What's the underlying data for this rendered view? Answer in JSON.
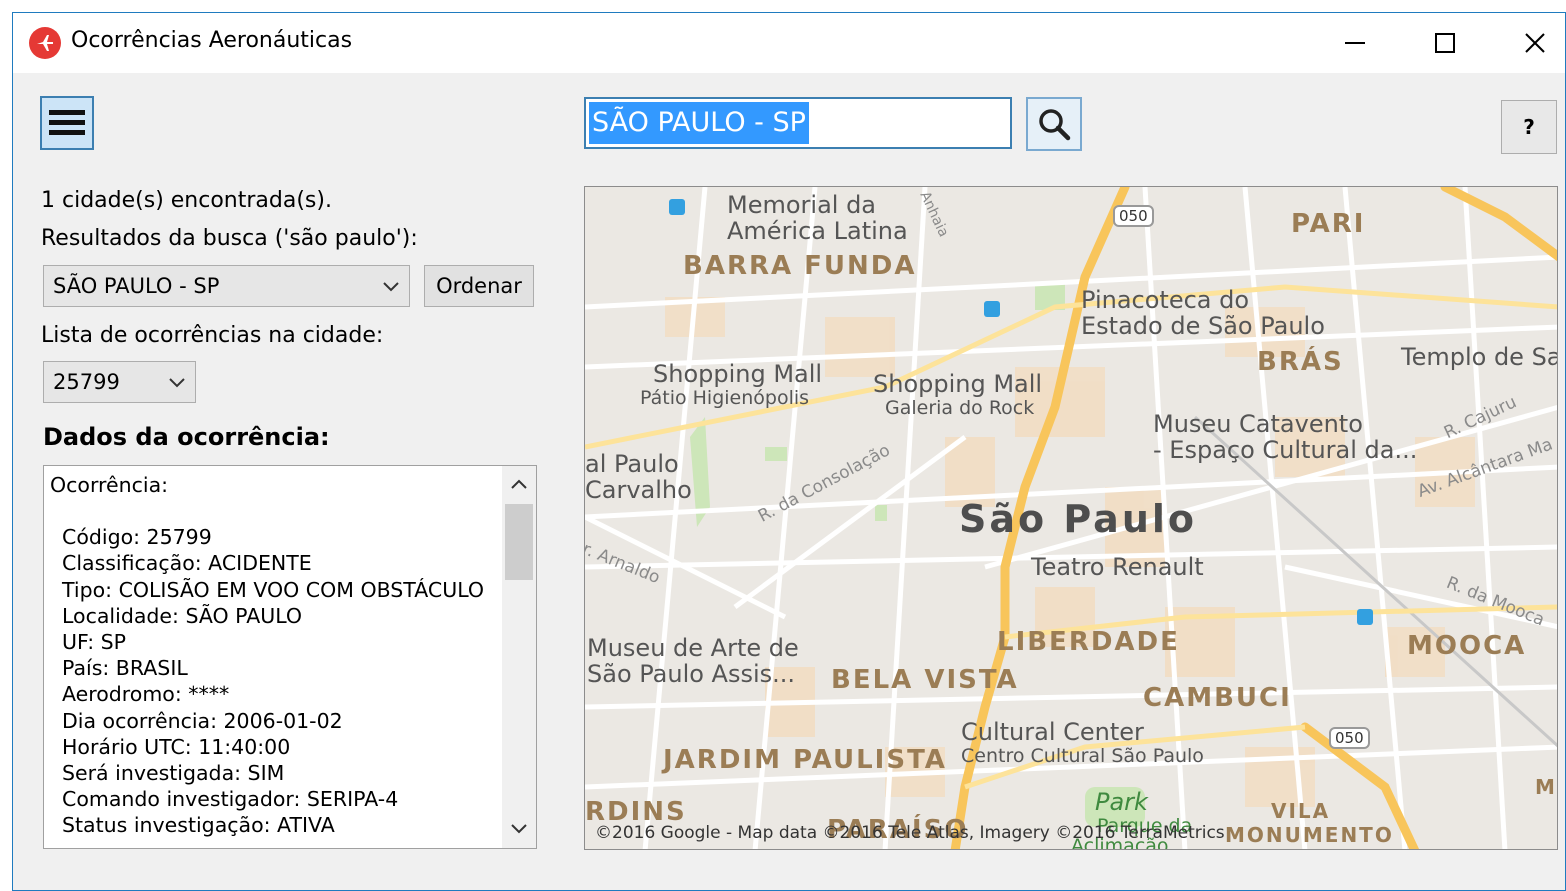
{
  "window": {
    "title": "Ocorrências Aeronáuticas"
  },
  "search": {
    "value": "SÃO PAULO - SP"
  },
  "help": {
    "label": "?"
  },
  "results": {
    "count_text": "1 cidade(s) encontrada(s).",
    "search_label": "Resultados da busca ('são paulo'):",
    "city_selected": "SÃO PAULO - SP",
    "sort_button": "Ordenar",
    "list_label": "Lista de ocorrências na cidade:",
    "occurrence_selected": "25799"
  },
  "details": {
    "title": "Dados da ocorrência:",
    "header": "Ocorrência:",
    "lines": [
      "Código: 25799",
      "Classificação: ACIDENTE",
      "Tipo: COLISÃO EM VOO COM OBSTÁCULO",
      "Localidade: SÃO PAULO",
      "UF: SP",
      "País: BRASIL",
      "Aerodromo: ****",
      "Dia ocorrência: 2006-01-02",
      "Horário UTC: 11:40:00",
      "Será investigada: SIM",
      "Comando investigador: SERIPA-4",
      "Status investigação: ATIVA"
    ]
  },
  "map": {
    "poi": {
      "memorial": "Memorial da\nAmérica Latina",
      "pinacoteca": "Pinacoteca do\nEstado de São Paulo",
      "templo": "Templo de Sa",
      "shopping1": "Shopping Mall",
      "shopping1_sub": "Pátio Higienópolis",
      "shopping2": "Shopping Mall",
      "shopping2_sub": "Galeria do Rock",
      "catavento": "Museu Catavento\n- Espaço Cultural da...",
      "paulo_carvalho": "al Paulo\nCarvalho",
      "teatro": "Teatro Renault",
      "masp": "Museu de Arte de\nSão Paulo Assis...",
      "cultural": "Cultural Center",
      "cultural_sub": "Centro Cultural São Paulo",
      "park": "Park",
      "parque": "Parque da",
      "aclimacao": "Aclimação"
    },
    "districts": {
      "barra_funda": "BARRA FUNDA",
      "pari": "PARI",
      "bras": "BRÁS",
      "liberdade": "LIBERDADE",
      "bela_vista": "BELA VISTA",
      "cambuci": "CAMBUCI",
      "mooca": "MOOCA",
      "jardim_paulista": "JARDIM PAULISTA",
      "jardins": "RDINS",
      "paraiso": "PARAÍSO",
      "vila": "VILA",
      "monumento": "MONUMENTO",
      "m": "M"
    },
    "city": "São Paulo",
    "streets": {
      "consolacao": "R. da Consolação",
      "arnaldo": "r. Arnaldo",
      "cajuru": "R. Cajuru",
      "alcantara": "Av. Alcântara Ma",
      "mooca": "R. da Mooca",
      "anhaia": "Anhaia"
    },
    "shields": {
      "s1": "050",
      "s2": "050"
    },
    "credit": "©2016 Google - Map data ©2016 Tele Atlas, Imagery ©2016 TerraMetrics"
  },
  "colors": {
    "accent": "#3c7fb1",
    "selection": "#3399ff",
    "map_major_road": "#f8c55b"
  }
}
